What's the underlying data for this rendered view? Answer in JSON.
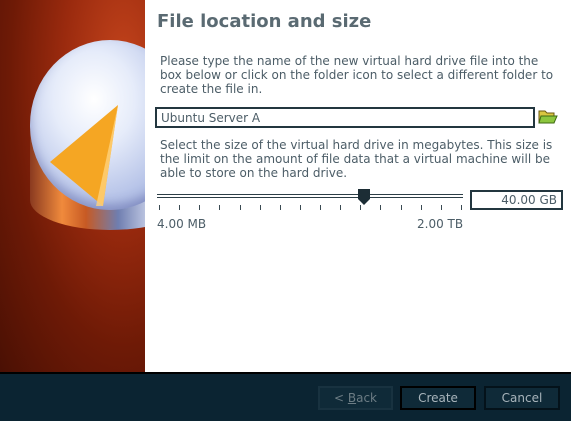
{
  "page": {
    "title": "File location and size",
    "instructions_location": "Please type the name of the new virtual hard drive file into the box below or click on the folder icon to select a different folder to create the file in.",
    "instructions_size": "Select the size of the virtual hard drive in megabytes. This size is the limit on the amount of file data that a virtual machine will be able to store on the hard drive."
  },
  "file": {
    "name": "Ubuntu Server A",
    "folder_icon": "folder-open-icon"
  },
  "size": {
    "value_text": "40.00 GB",
    "min_label": "4.00 MB",
    "max_label": "2.00 TB",
    "slider_fraction": 0.68,
    "tick_count": 16
  },
  "buttons": {
    "back_prefix": "< ",
    "back_underlined": "B",
    "back_rest": "ack",
    "create": "Create",
    "cancel": "Cancel"
  },
  "colors": {
    "sidebar_dark": "#4a1004",
    "sidebar_light": "#c4441c",
    "text": "#4c5d67",
    "title": "#5a6a72",
    "footer": "#0b2432"
  }
}
